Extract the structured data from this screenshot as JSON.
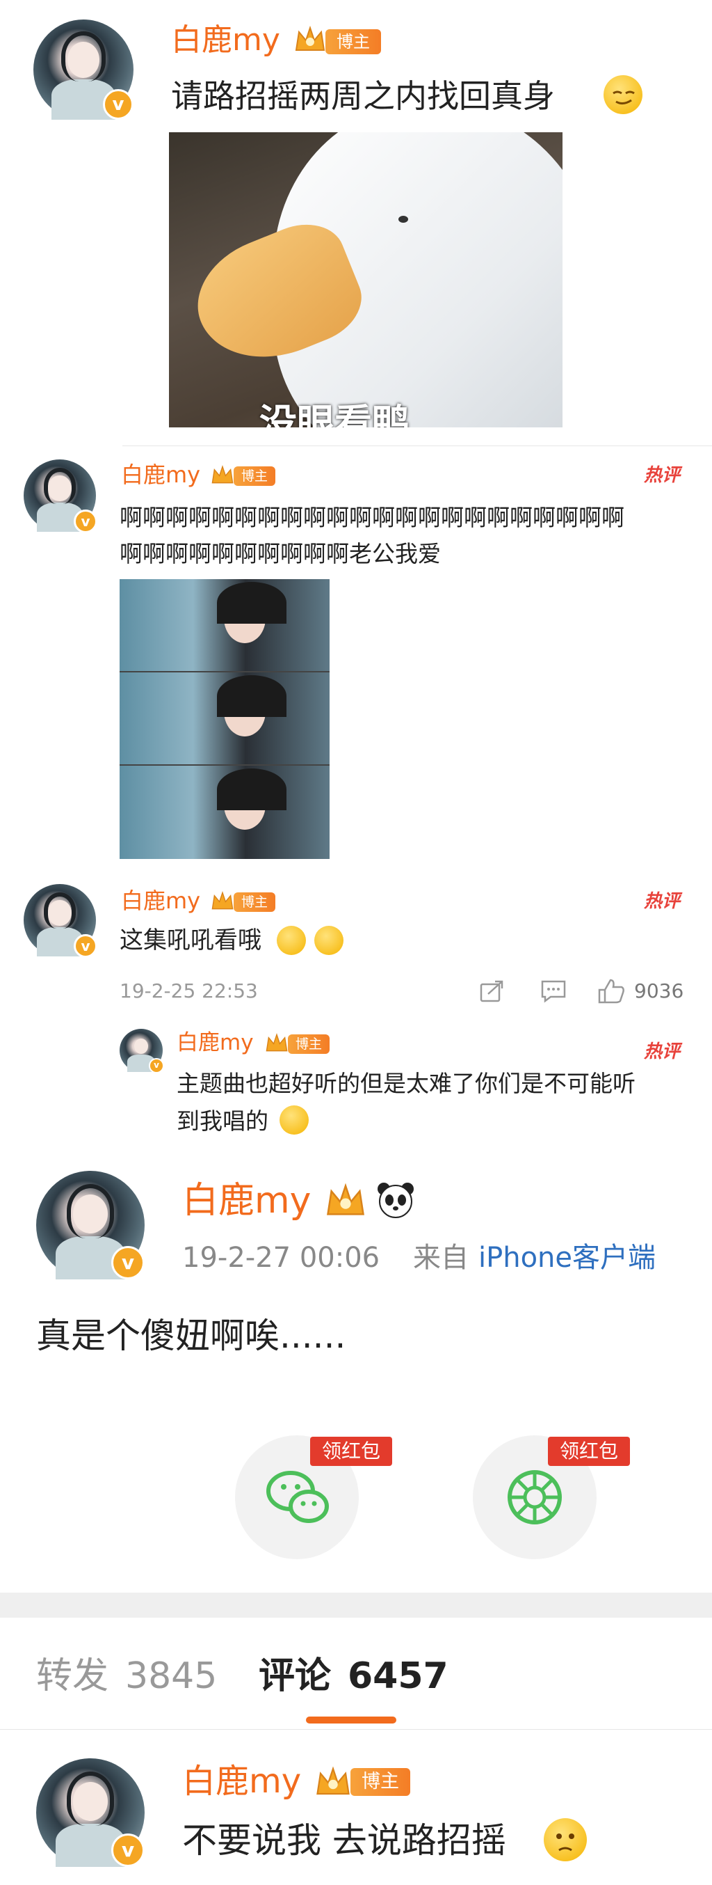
{
  "username": "白鹿my",
  "bozhu_badge": "博主",
  "hot_label": "热评",
  "post1": {
    "text": "请路招摇两周之内找回真身",
    "image_caption": "没眼看鸭"
  },
  "comment1": {
    "text_line1": "啊啊啊啊啊啊啊啊啊啊啊啊啊啊啊啊啊啊啊啊啊啊",
    "text_line2": "啊啊啊啊啊啊啊啊啊啊老公我爱"
  },
  "comment2": {
    "text": "这集吼吼看哦",
    "time": "19-2-25 22:53",
    "likes": "9036"
  },
  "reply": {
    "text_line1": "主题曲也超好听的但是太难了你们是不可能听",
    "text_line2": "到我唱的"
  },
  "main_post": {
    "time": "19-2-27 00:06",
    "source_prefix": "来自",
    "source": "iPhone客户端",
    "text": "真是个傻妞啊唉......",
    "hongbao_label": "领红包"
  },
  "tabs": {
    "repost_label": "转发",
    "repost_count": "3845",
    "comment_label": "评论",
    "comment_count": "6457"
  },
  "last_comment": {
    "text": "不要说我 去说路招摇"
  },
  "icons": {
    "vip": "crown-icon",
    "verified": "verified-badge-icon",
    "share": "share-icon",
    "comment": "comment-icon",
    "like": "like-icon",
    "wechat": "wechat-icon",
    "moments": "wechat-moments-icon"
  },
  "colors": {
    "accent_orange": "#f26b1d",
    "link_blue": "#2e6fbf",
    "hot_red": "#e8423b",
    "wechat_green": "#4cbf5a"
  }
}
